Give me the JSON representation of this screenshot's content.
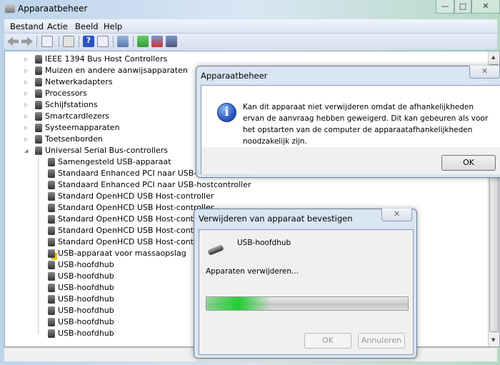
{
  "window": {
    "title": "Apparaatbeheer",
    "controls": {
      "minimize": "—",
      "maximize": "□",
      "close": "✕"
    }
  },
  "menu": [
    "Bestand",
    "Actie",
    "Beeld",
    "Help"
  ],
  "toolbar": [
    "back-icon",
    "forward-icon",
    "show-hide-tree-icon",
    "properties-icon",
    "help-icon",
    "action-pane-icon",
    "scan-hardware-icon",
    "update-driver-icon",
    "uninstall-icon",
    "disable-icon"
  ],
  "tree": {
    "categories": [
      {
        "label": "IEEE 1394 Bus Host Controllers",
        "icon": "usb-icon"
      },
      {
        "label": "Muizen en andere aanwijsapparaten",
        "icon": "mouse-icon"
      },
      {
        "label": "Netwerkadapters",
        "icon": "network-icon"
      },
      {
        "label": "Processors",
        "icon": "processor-icon"
      },
      {
        "label": "Schijfstations",
        "icon": "disk-icon"
      },
      {
        "label": "Smartcardlezers",
        "icon": "smartcard-icon"
      },
      {
        "label": "Systeemapparaten",
        "icon": "system-icon"
      },
      {
        "label": "Toetsenborden",
        "icon": "keyboard-icon"
      },
      {
        "label": "Universal Serial Bus-controllers",
        "icon": "usb-icon",
        "expanded": true
      }
    ],
    "usb_children": [
      "Samengesteld USB-apparaat",
      "Standaard Enhanced PCI naar USB-hostcontroller",
      "Standaard Enhanced PCI naar USB-hostcontroller",
      "Standard OpenHCD USB Host-controller",
      "Standard OpenHCD USB Host-controller",
      "Standard OpenHCD USB Host-controller",
      "Standard OpenHCD USB Host-controller",
      "Standard OpenHCD USB Host-controller",
      "USB-apparaat voor massaopslag",
      "USB-hoofdhub",
      "USB-hoofdhub",
      "USB-hoofdhub",
      "USB-hoofdhub",
      "USB-hoofdhub",
      "USB-hoofdhub",
      "USB-hoofdhub"
    ]
  },
  "error_dialog": {
    "title": "Apparaatbeheer",
    "message": "Kan dit apparaat niet verwijderen omdat de afhankelijkheden ervan de aanvraag hebben geweigerd. Dit kan gebeuren als voor het opstarten van de computer de apparaatafhankelijkheden noodzakelijk zijn.",
    "ok": "OK",
    "close": "✕"
  },
  "confirm_dialog": {
    "title": "Verwijderen van apparaat bevestigen",
    "device": "USB-hoofdhub",
    "status": "Apparaten verwijderen...",
    "progress_state": "indeterminate",
    "ok": "OK",
    "cancel": "Annuleren",
    "close": "✕"
  },
  "colors": {
    "progress": "#22cc33",
    "info": "#2a5bbf"
  }
}
